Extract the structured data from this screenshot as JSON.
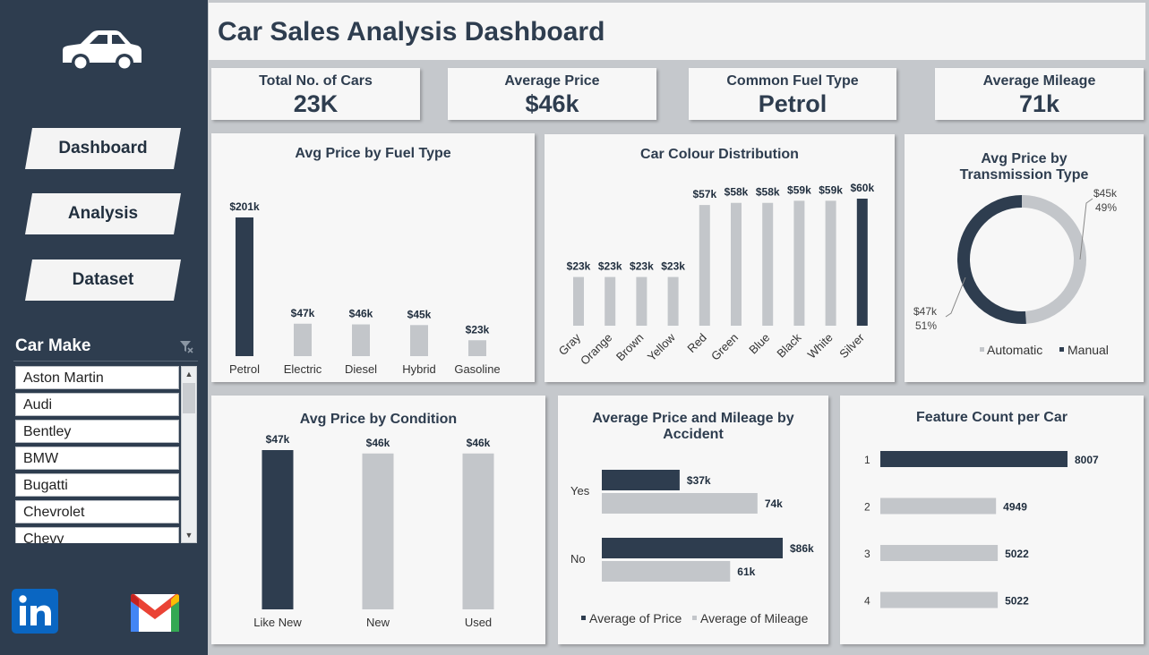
{
  "title": "Car Sales Analysis Dashboard",
  "colors": {
    "sidebar": "#2e3d4f",
    "dark_bar": "#2e3d4f",
    "light_bar": "#c3c6ca",
    "panel_bg": "#f7f7f7"
  },
  "nav": {
    "dashboard": "Dashboard",
    "analysis": "Analysis",
    "dataset": "Dataset"
  },
  "slicer": {
    "title": "Car Make",
    "items": [
      "Aston Martin",
      "Audi",
      "Bentley",
      "BMW",
      "Bugatti",
      "Chevrolet",
      "Chevy"
    ]
  },
  "kpis": [
    {
      "label": "Total No. of Cars",
      "value": "23K"
    },
    {
      "label": "Average Price",
      "value": "$46k"
    },
    {
      "label": "Common Fuel Type",
      "value": "Petrol"
    },
    {
      "label": "Average Mileage",
      "value": "71k"
    }
  ],
  "icons": {
    "logo": "car-icon",
    "clear_filter": "clear-filter-icon",
    "linkedin": "linkedin-icon",
    "gmail": "gmail-icon"
  },
  "chart_data": [
    {
      "id": "fuel",
      "type": "bar",
      "title": "Avg Price by Fuel Type",
      "categories": [
        "Petrol",
        "Electric",
        "Diesel",
        "Hybrid",
        "Gasoline"
      ],
      "values": [
        201,
        47,
        46,
        45,
        23
      ],
      "labels": [
        "$201k",
        "$47k",
        "$46k",
        "$45k",
        "$23k"
      ],
      "highlight": [
        true,
        false,
        false,
        false,
        false
      ]
    },
    {
      "id": "colour",
      "type": "bar",
      "title": "Car Colour Distribution",
      "categories": [
        "Gray",
        "Orange",
        "Brown",
        "Yellow",
        "Red",
        "Green",
        "Blue",
        "Black",
        "White",
        "Silver"
      ],
      "values": [
        23,
        23,
        23,
        23,
        57,
        58,
        58,
        59,
        59,
        60
      ],
      "labels": [
        "$23k",
        "$23k",
        "$23k",
        "$23k",
        "$57k",
        "$58k",
        "$58k",
        "$59k",
        "$59k",
        "$60k"
      ],
      "highlight": [
        false,
        false,
        false,
        false,
        false,
        false,
        false,
        false,
        false,
        true
      ]
    },
    {
      "id": "transmission",
      "type": "pie",
      "title": "Avg Price by Transmission Type",
      "title_lines": [
        "Avg Price by",
        "Transmission Type"
      ],
      "slices": [
        {
          "name": "Automatic",
          "value": 45,
          "label": "$45k",
          "pct": "49%",
          "color": "#c3c6ca"
        },
        {
          "name": "Manual",
          "value": 47,
          "label": "$47k",
          "pct": "51%",
          "color": "#2e3d4f"
        }
      ],
      "legend": "bottom"
    },
    {
      "id": "condition",
      "type": "bar",
      "title": "Avg Price by Condition",
      "categories": [
        "Like New",
        "New",
        "Used"
      ],
      "values": [
        47,
        46,
        46
      ],
      "labels": [
        "$47k",
        "$46k",
        "$46k"
      ],
      "highlight": [
        true,
        false,
        false
      ]
    },
    {
      "id": "accident",
      "type": "bar",
      "orientation": "horizontal",
      "title": "Average Price and Mileage by Accident",
      "title_lines": [
        "Average Price and Mileage by",
        "Accident"
      ],
      "categories": [
        "Yes",
        "No"
      ],
      "series": [
        {
          "name": "Average of Price",
          "values": [
            37,
            86
          ],
          "labels": [
            "$37k",
            "$86k"
          ],
          "color": "#2e3d4f"
        },
        {
          "name": "Average of Mileage",
          "values": [
            74,
            61
          ],
          "labels": [
            "74k",
            "61k"
          ],
          "color": "#c3c6ca"
        }
      ],
      "legend": "bottom"
    },
    {
      "id": "features",
      "type": "bar",
      "orientation": "horizontal",
      "title": "Feature Count per Car",
      "categories": [
        "1",
        "2",
        "3",
        "4"
      ],
      "values": [
        8007,
        4949,
        5022,
        5022
      ],
      "labels": [
        "8007",
        "4949",
        "5022",
        "5022"
      ],
      "highlight": [
        true,
        false,
        false,
        false
      ]
    }
  ]
}
